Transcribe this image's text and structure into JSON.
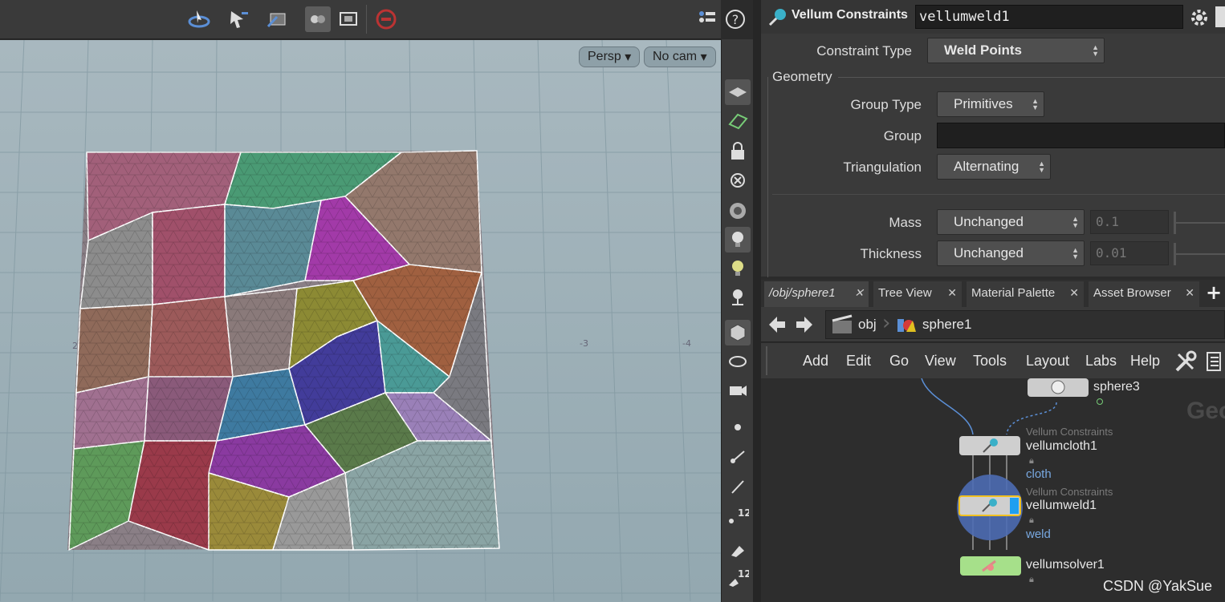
{
  "viewport": {
    "camera_persp": "Persp",
    "camera_nocam": "No cam",
    "grid_labels": [
      "2",
      "-3",
      "-4"
    ]
  },
  "params": {
    "node_type": "Vellum Constraints",
    "node_name": "vellumweld1",
    "constraint_type_label": "Constraint Type",
    "constraint_type_value": "Weld Points",
    "geometry_section": "Geometry",
    "group_type_label": "Group Type",
    "group_type_value": "Primitives",
    "group_label": "Group",
    "group_value": "",
    "triangulation_label": "Triangulation",
    "triangulation_value": "Alternating",
    "mass_label": "Mass",
    "mass_mode": "Unchanged",
    "mass_value": "0.1",
    "thickness_label": "Thickness",
    "thickness_mode": "Unchanged",
    "thickness_value": "0.01"
  },
  "tabs": [
    {
      "label": "/obj/sphere1",
      "active": true
    },
    {
      "label": "Tree View",
      "active": false
    },
    {
      "label": "Material Palette",
      "active": false
    },
    {
      "label": "Asset Browser",
      "active": false
    }
  ],
  "path": {
    "level1": "obj",
    "level2": "sphere1"
  },
  "network_menu": [
    "Add",
    "Edit",
    "Go",
    "View",
    "Tools",
    "Layout",
    "Labs",
    "Help"
  ],
  "network": {
    "sphere3": "sphere3",
    "cloth_type": "Vellum Constraints",
    "cloth_name": "vellumcloth1",
    "cloth_tag": "cloth",
    "weld_type": "Vellum Constraints",
    "weld_name": "vellumweld1",
    "weld_tag": "weld",
    "solver_name": "vellumsolver1",
    "watermark_context": "Geo"
  },
  "watermark": "CSDN @YakSue",
  "colors": {
    "viewport_bg": "#9fb3bb",
    "panel_bg": "#3a3a3a",
    "selected_node_outline": "#f0c020",
    "solver_node": "#a6e08a"
  }
}
